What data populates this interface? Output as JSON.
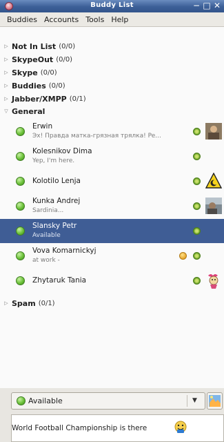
{
  "window": {
    "title": "Buddy List",
    "controls": {
      "minimize": "−",
      "maximize": "□",
      "close": "✕"
    }
  },
  "menubar": {
    "items": [
      "Buddies",
      "Accounts",
      "Tools",
      "Help"
    ]
  },
  "groups": [
    {
      "name": "Not In List",
      "count": "(0/0)",
      "expanded": false
    },
    {
      "name": "SkypeOut",
      "count": "(0/0)",
      "expanded": false
    },
    {
      "name": "Skype",
      "count": "(0/0)",
      "expanded": false
    },
    {
      "name": "Buddies",
      "count": "(0/0)",
      "expanded": false
    },
    {
      "name": "Jabber/XMPP",
      "count": "(0/1)",
      "expanded": false
    },
    {
      "name": "General",
      "count": "",
      "expanded": true
    },
    {
      "name": "Spam",
      "count": "(0/1)",
      "expanded": false
    }
  ],
  "buddies": [
    {
      "name": "Erwin",
      "message": "Эх! Правда матка-грязная трялка! Pe...",
      "has_icon": true,
      "icon": "photo-icon"
    },
    {
      "name": "Kolesnikov Dima",
      "message": "Yep, I'm here.",
      "has_icon": false
    },
    {
      "name": "Kolotilo Lenja",
      "message": "",
      "has_icon": true,
      "icon": "warning-moon-icon"
    },
    {
      "name": "Kunka Andrej",
      "message": "Sardinia...",
      "has_icon": true,
      "icon": "photo-icon"
    },
    {
      "name": "Slansky Petr",
      "message": "Available",
      "has_icon": false,
      "selected": true
    },
    {
      "name": "Vova Komarnickyj",
      "message": "at work -",
      "has_icon": false,
      "emote": true
    },
    {
      "name": "Zhytaruk Tania",
      "message": "",
      "has_icon": true,
      "icon": "cartoon-icon"
    }
  ],
  "status_selector": {
    "label": "Available"
  },
  "status_message": {
    "text": "World Football Championship is there"
  },
  "colors": {
    "titlebar": "#3c5f97",
    "selection": "#3f5d95",
    "available_green": "#6cc23a"
  }
}
